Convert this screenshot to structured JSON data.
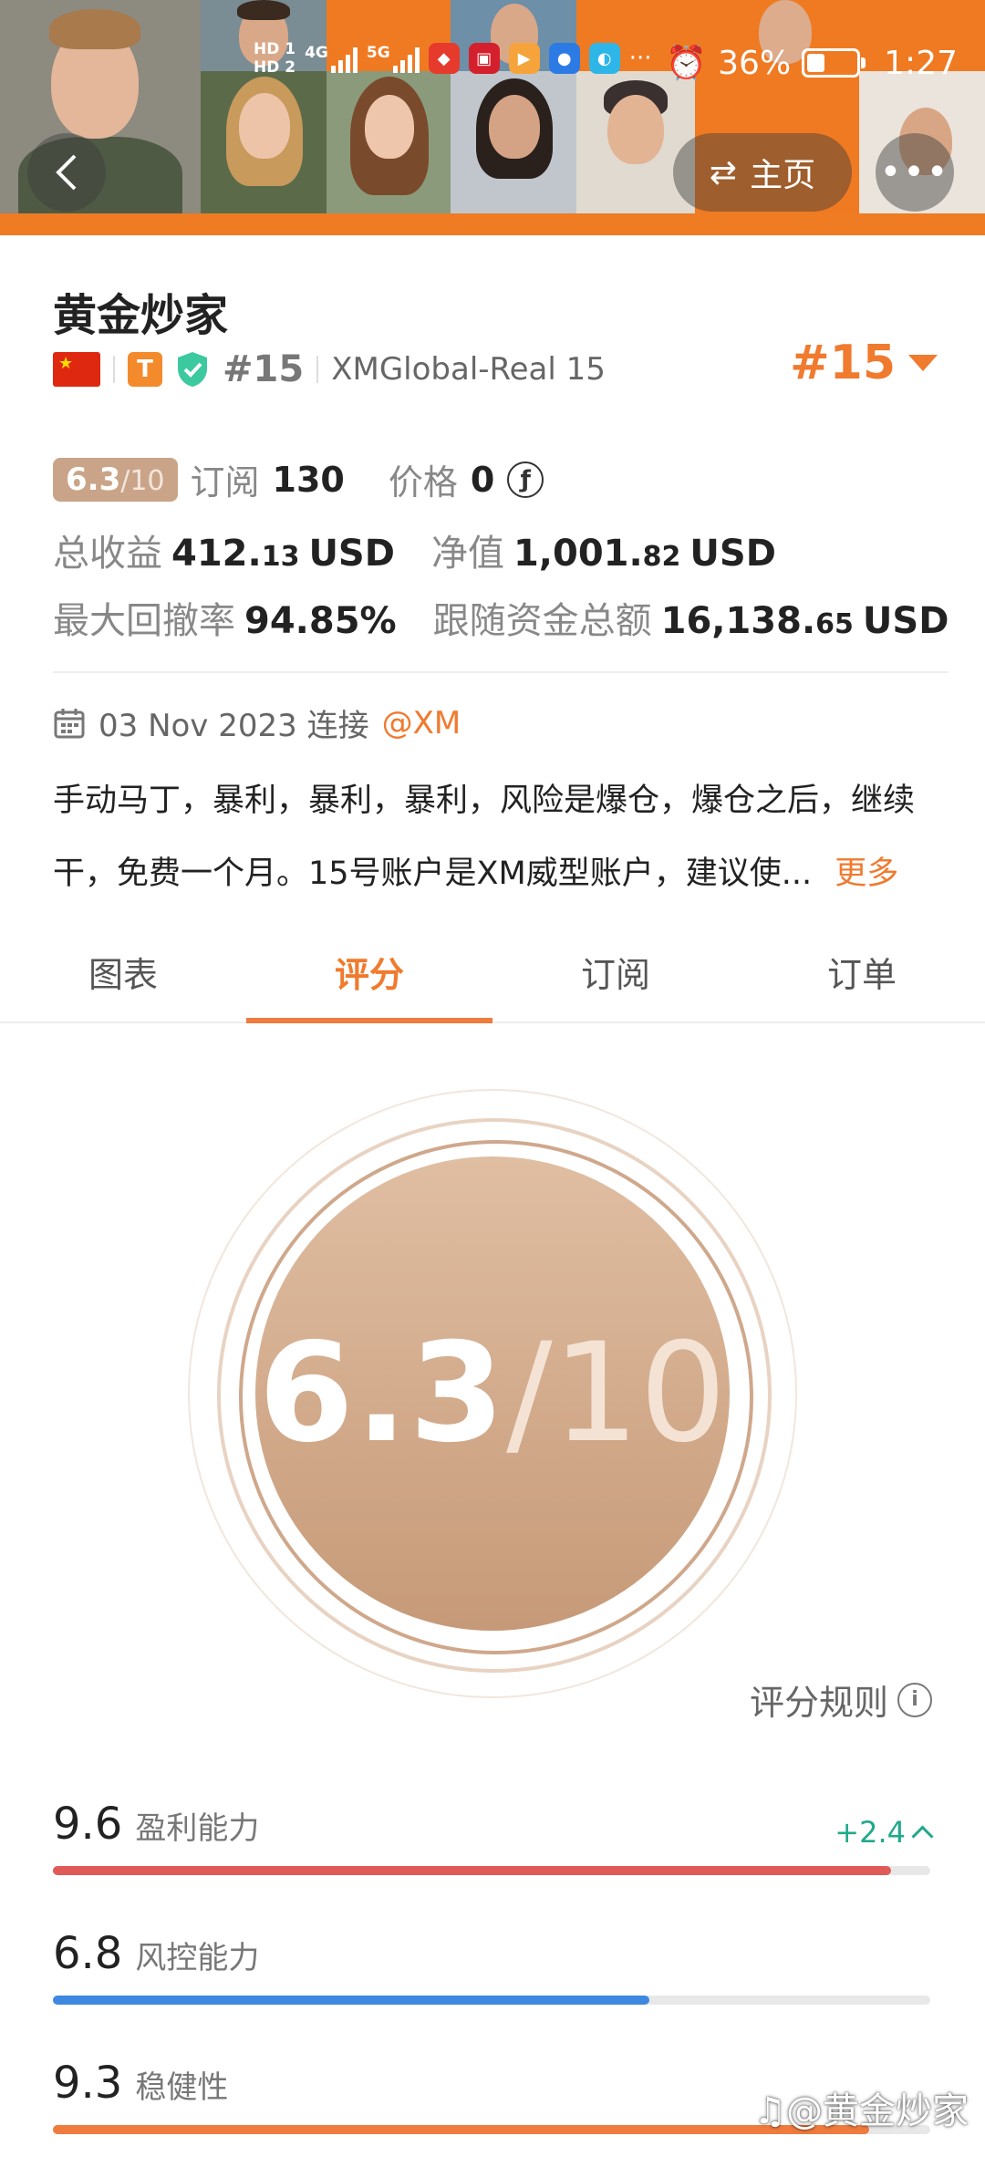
{
  "status_bar": {
    "hd1": "HD 1",
    "hd2": "HD 2",
    "net1": "4G",
    "net2": "5G",
    "overflow": "···",
    "battery": "36%",
    "battery_level_fraction": 0.36,
    "time": "1:27"
  },
  "nav": {
    "home_label": "主页"
  },
  "profile": {
    "name": "黄金炒家",
    "t_badge": "T",
    "rank_small": "#15",
    "account": "XMGlobal-Real 15",
    "rank_big": "#15",
    "score_value": "6.3",
    "score_denom": "/10",
    "subscribe_label": "订阅",
    "subscribe_count": "130",
    "price_label": "价格",
    "price_value": "0",
    "price_icon": "ƒ",
    "total_profit_label": "总收益",
    "total_profit_int": "412.",
    "total_profit_dec": "13",
    "total_profit_unit": "USD",
    "equity_label": "净值",
    "equity_int": "1,001.",
    "equity_dec": "82",
    "equity_unit": "USD",
    "drawdown_label": "最大回撤率",
    "drawdown_value": "94.85%",
    "follow_label": "跟随资金总额",
    "follow_int": "16,138.",
    "follow_dec": "65",
    "follow_unit": "USD",
    "connect_date": "03 Nov 2023 连接",
    "broker": "@XM",
    "description": "手动马丁，暴利，暴利，暴利，风险是爆仓，爆仓之后，继续干，免费一个月。15号账户是XM威型账户，建议使...",
    "more_link": "更多"
  },
  "tabs": [
    {
      "label": "图表"
    },
    {
      "label": "评分"
    },
    {
      "label": "订阅"
    },
    {
      "label": "订单"
    }
  ],
  "score": {
    "value": "6.3",
    "denom": "/10",
    "rules_label": "评分规则",
    "info_glyph": "i"
  },
  "metrics": [
    {
      "value": "9.6",
      "label": "盈利能力",
      "fraction": 0.955,
      "color": "#e05a58",
      "delta": "+2.4"
    },
    {
      "value": "6.8",
      "label": "风控能力",
      "fraction": 0.68,
      "color": "#3e88e0"
    },
    {
      "value": "9.3",
      "label": "稳健性",
      "fraction": 0.93,
      "color": "#ef7b3e"
    }
  ],
  "colors": {
    "accent": "#f07a2e",
    "score_bg": "#caa488",
    "positive": "#21a88b"
  },
  "watermark": "♫@黄金炒家"
}
